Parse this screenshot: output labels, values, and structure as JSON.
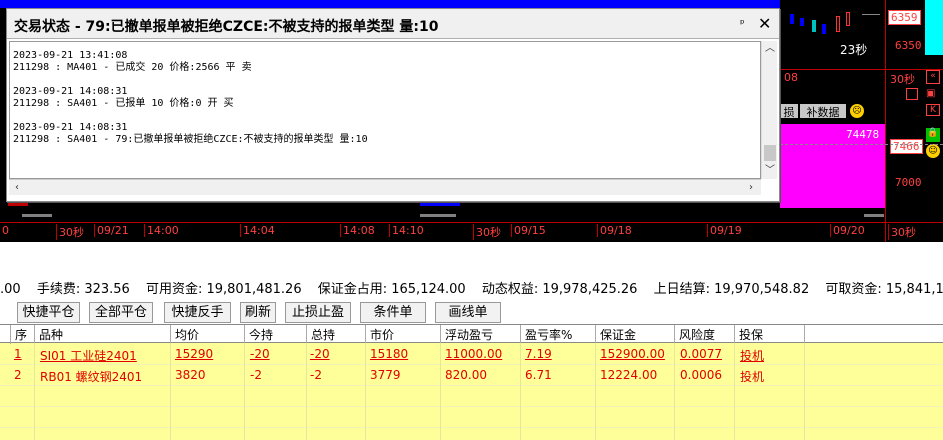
{
  "colors": {
    "up": "#ff2020",
    "down": "#2040ff",
    "accent": "#ff00ff",
    "bg": "#000000",
    "table_bg": "#ffff99"
  },
  "chart": {
    "right_ticks": [
      "6359",
      "6350",
      "7466",
      "7000"
    ],
    "timer_right": "23秒",
    "timer_right2": "30秒",
    "timer_mid": "30秒",
    "timer_far": "30秒",
    "price_label": "7466",
    "price_label2": "74478",
    "chip_text": "补数据",
    "chip_text2": "损",
    "time_axis": [
      "0",
      "30秒",
      "09/21",
      "14:00",
      "14:04",
      "14:08",
      "14:10",
      "30秒",
      "09/15",
      "09/18",
      "09/19",
      "09/20",
      "30秒"
    ]
  },
  "dialog": {
    "title": "交易状态 - 79:已撤单报单被拒绝CZCE:不被支持的报单类型 量:10",
    "pin": "ᵖ",
    "close": "✕",
    "log": "2023-09-21 13:41:08\n211298 : MA401 - 已成交 20 价格:2566 平 卖\n\n2023-09-21 14:08:31\n211298 : SA401 - 已报单 10 价格:0 开 买\n\n2023-09-21 14:08:31\n211298 : SA401 - 79:已撤单报单被拒绝CZCE:不被支持的报单类型 量:10"
  },
  "summary": {
    "a": ".00",
    "fee": "手续费: 323.56",
    "avail": "可用资金: 19,801,481.26",
    "margin": "保证金占用: 165,124.00",
    "equity": "动态权益: 19,978,425.26",
    "prev": "上日结算: 19,970,548.82",
    "withdraw": "可取资金: 15,841,185.00"
  },
  "toolbar": {
    "b1": "快捷平仓",
    "b2": "全部平仓",
    "b3": "快捷反手",
    "b4": "刷新",
    "b5": "止损止盈",
    "b6": "条件单",
    "b7": "画线单"
  },
  "table": {
    "headers": [
      "序",
      "品种",
      "均价",
      "今持",
      "总持",
      "市价",
      "浮动盈亏",
      "盈亏率%",
      "保证金",
      "风险度",
      "投保"
    ],
    "rows": [
      [
        "1",
        "SI01 工业硅2401",
        "15290",
        "-20",
        "-20",
        "15180",
        "11000.00",
        "7.19",
        "152900.00",
        "0.0077",
        "投机"
      ],
      [
        "2",
        "RB01 螺纹钢2401",
        "3820",
        "-2",
        "-2",
        "3779",
        "820.00",
        "6.71",
        "12224.00",
        "0.0006",
        "投机"
      ]
    ]
  }
}
